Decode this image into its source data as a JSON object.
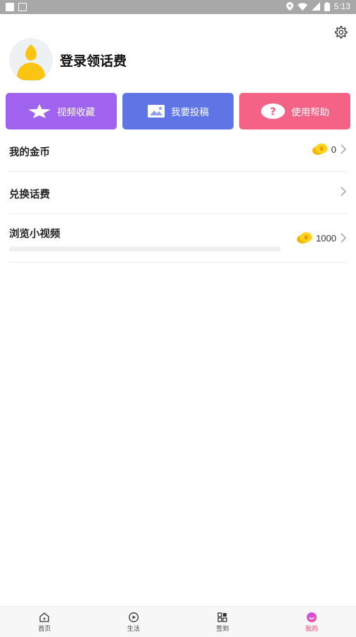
{
  "status_bar": {
    "time": "5:13"
  },
  "profile": {
    "login_title": "登录领话费"
  },
  "actions": [
    {
      "label": "视频收藏",
      "icon": "star-icon",
      "color": "#9f63f0"
    },
    {
      "label": "我要投稿",
      "icon": "image-icon",
      "color": "#5f75e6"
    },
    {
      "label": "使用帮助",
      "icon": "question-icon",
      "color": "#f46286"
    }
  ],
  "rows": {
    "coins": {
      "label": "我的金币",
      "value": "0"
    },
    "exchange": {
      "label": "兑换话费"
    },
    "browse": {
      "label": "浏览小视频",
      "value": "1000",
      "progress": 0
    }
  },
  "tabs": [
    {
      "label": "首页",
      "icon": "home-icon"
    },
    {
      "label": "生活",
      "icon": "play-circle-icon"
    },
    {
      "label": "签到",
      "icon": "grid-icon"
    },
    {
      "label": "我的",
      "icon": "profile-icon",
      "active": true
    }
  ],
  "colors": {
    "accent": "#ee4c7a",
    "coin": "#f7c300"
  }
}
